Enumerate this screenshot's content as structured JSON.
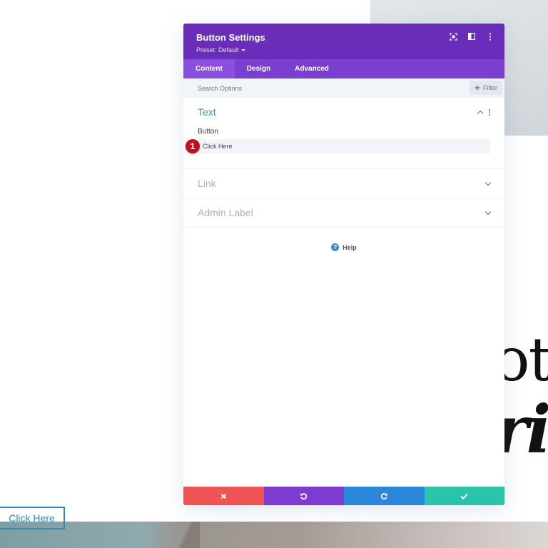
{
  "background": {
    "heading_line1": "ota",
    "heading_line2": "ri",
    "button_label": "Click Here"
  },
  "modal": {
    "title": "Button Settings",
    "preset": "Preset: Default",
    "header_icons": [
      "focus-icon",
      "split-view-icon",
      "more-options-icon"
    ],
    "tabs": [
      {
        "label": "Content",
        "active": true
      },
      {
        "label": "Design",
        "active": false
      },
      {
        "label": "Advanced",
        "active": false
      }
    ],
    "search": {
      "placeholder": "Search Options",
      "value": ""
    },
    "filter_label": "Filter",
    "sections": {
      "text": {
        "title": "Text",
        "expanded": true,
        "field_label": "Button",
        "field_value": "Click Here",
        "step_badge": "1"
      },
      "link": {
        "title": "Link",
        "expanded": false
      },
      "admin_label": {
        "title": "Admin Label",
        "expanded": false
      }
    },
    "help_label": "Help",
    "help_icon": "?",
    "footer": {
      "cancel": {
        "icon": "close-icon",
        "color": "#ef5555"
      },
      "undo": {
        "icon": "undo-icon",
        "color": "#7e3bd0"
      },
      "redo": {
        "icon": "redo-icon",
        "color": "#2b87da"
      },
      "save": {
        "icon": "check-icon",
        "color": "#29c4a9"
      }
    }
  },
  "colors": {
    "header": "#6a2db9",
    "tabs": "#7b3fd0",
    "accent_blue": "#3f8fc4",
    "badge_red": "#c0101c"
  }
}
